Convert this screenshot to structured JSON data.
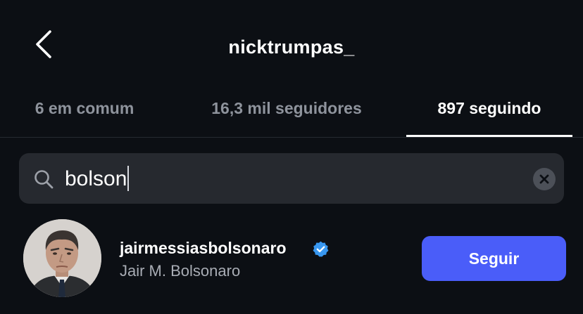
{
  "header": {
    "back_icon": "chevron-left-icon",
    "title": "nicktrumpas_"
  },
  "tabs": [
    {
      "label": "6 em comum",
      "active": false
    },
    {
      "label": "16,3 mil seguidores",
      "active": false
    },
    {
      "label": "897 seguindo",
      "active": true
    }
  ],
  "search": {
    "icon": "search-icon",
    "value": "bolson",
    "clear_icon": "clear-icon"
  },
  "results": [
    {
      "avatar": "profile-photo",
      "username": "jairmessiasbolsonaro",
      "verified": true,
      "full_name": "Jair M. Bolsonaro",
      "button_label": "Seguir"
    }
  ],
  "colors": {
    "background": "#0c0f14",
    "accent": "#4a5df9",
    "verified": "#3897f0",
    "muted_text": "#8e939c",
    "search_bg": "#26292f"
  }
}
